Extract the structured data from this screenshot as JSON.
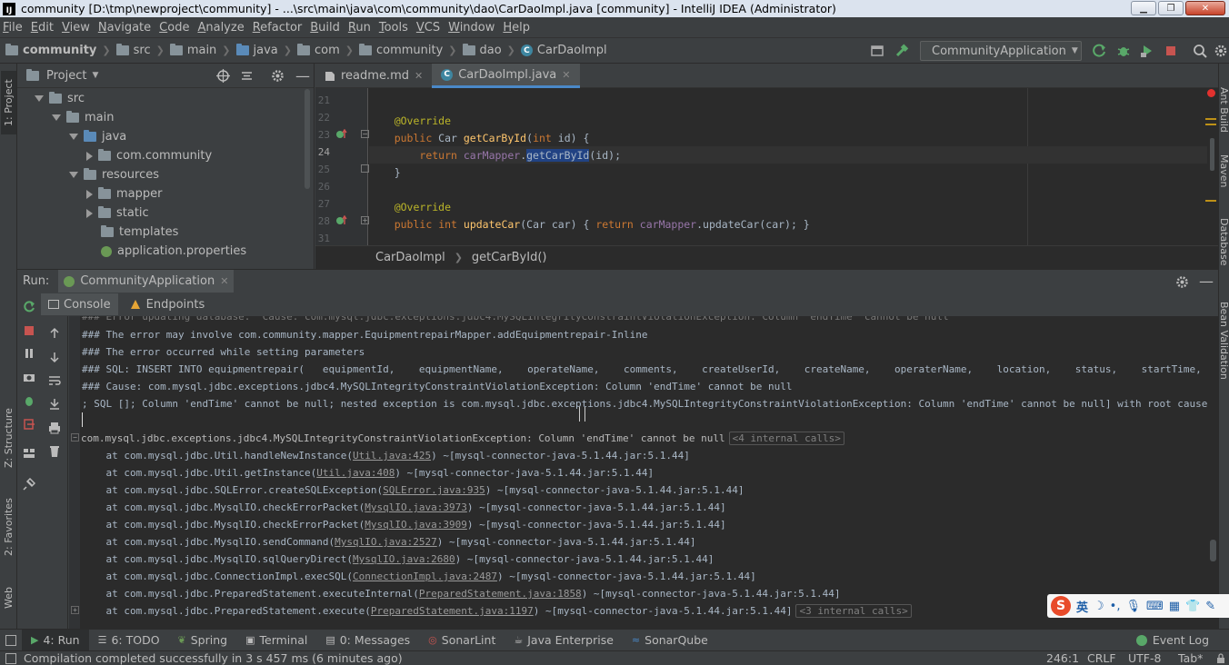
{
  "window": {
    "title": "community [D:\\tmp\\newproject\\community] - ...\\src\\main\\java\\com\\community\\dao\\CarDaoImpl.java [community] - IntelliJ IDEA (Administrator)",
    "app_icon_text": "IJ"
  },
  "menu": [
    "File",
    "Edit",
    "View",
    "Navigate",
    "Code",
    "Analyze",
    "Refactor",
    "Build",
    "Run",
    "Tools",
    "VCS",
    "Window",
    "Help"
  ],
  "breadcrumbs": [
    "community",
    "src",
    "main",
    "java",
    "com",
    "community",
    "dao",
    "CarDaoImpl"
  ],
  "run_config": {
    "name": "CommunityApplication"
  },
  "left_stripe": {
    "project": "1: Project",
    "structure": "Z: Structure",
    "favorites": "2: Favorites",
    "web": "Web"
  },
  "right_stripe": {
    "ant": "Ant Build",
    "maven": "Maven",
    "database": "Database",
    "bean": "Bean Validation"
  },
  "project_panel": {
    "title": "Project",
    "tree": [
      {
        "label": "src",
        "indent": 0,
        "state": "open",
        "icon": "folder"
      },
      {
        "label": "main",
        "indent": 1,
        "state": "open",
        "icon": "folder"
      },
      {
        "label": "java",
        "indent": 2,
        "state": "open",
        "icon": "folder-blue"
      },
      {
        "label": "com.community",
        "indent": 3,
        "state": "closed",
        "icon": "folder"
      },
      {
        "label": "resources",
        "indent": 2,
        "state": "open",
        "icon": "folder"
      },
      {
        "label": "mapper",
        "indent": 3,
        "state": "closed",
        "icon": "folder"
      },
      {
        "label": "static",
        "indent": 3,
        "state": "closed",
        "icon": "folder"
      },
      {
        "label": "templates",
        "indent": 3,
        "state": "none",
        "icon": "folder"
      },
      {
        "label": "application.properties",
        "indent": 3,
        "state": "none",
        "icon": "leaf"
      }
    ]
  },
  "editor": {
    "tabs": [
      {
        "label": "readme.md",
        "active": false
      },
      {
        "label": "CarDaoImpl.java",
        "active": true
      }
    ],
    "lines": [
      {
        "num": "21",
        "text": ""
      },
      {
        "num": "22",
        "text": "    @Override"
      },
      {
        "num": "23",
        "text": "    public Car getCarById(int id) {"
      },
      {
        "num": "24",
        "text": "        return carMapper.getCarById(id);"
      },
      {
        "num": "25",
        "text": "    }"
      },
      {
        "num": "26",
        "text": ""
      },
      {
        "num": "27",
        "text": "    @Override"
      },
      {
        "num": "28",
        "text": "    public int updateCar(Car car) { return carMapper.updateCar(car); }"
      },
      {
        "num": "31",
        "text": ""
      }
    ],
    "crumbs": [
      "CarDaoImpl",
      "getCarById()"
    ]
  },
  "run_panel": {
    "label": "Run:",
    "tab": "CommunityApplication",
    "subtabs": [
      "Console",
      "Endpoints"
    ]
  },
  "console": {
    "lines": [
      "### The error may involve com.community.mapper.EquipmentrepairMapper.addEquipmentrepair-Inline",
      "### The error occurred while setting parameters",
      "### SQL: INSERT INTO equipmentrepair(   equipmentId,    equipmentName,    operateName,    comments,    createUserId,    createName,    operaterName,    location,    status,    startTime,    endTime,    fee,",
      "### Cause: com.mysql.jdbc.exceptions.jdbc4.MySQLIntegrityConstraintViolationException: Column 'endTime' cannot be null",
      "; SQL []; Column 'endTime' cannot be null; nested exception is com.mysql.jdbc.exceptions.jdbc4.MySQLIntegrityConstraintViolationException: Column 'endTime' cannot be null] with root cause",
      ""
    ],
    "exception": "com.mysql.jdbc.exceptions.jdbc4.MySQLIntegrityConstraintViolationException: Column 'endTime' cannot be null",
    "exception_fold": "<4 internal calls>",
    "stack": [
      {
        "pre": "    at com.mysql.jdbc.Util.handleNewInstance(",
        "link": "Util.java:425",
        "post": ") ~[mysql-connector-java-5.1.44.jar:5.1.44]",
        "fold": ""
      },
      {
        "pre": "    at com.mysql.jdbc.Util.getInstance(",
        "link": "Util.java:408",
        "post": ") ~[mysql-connector-java-5.1.44.jar:5.1.44]",
        "fold": ""
      },
      {
        "pre": "    at com.mysql.jdbc.SQLError.createSQLException(",
        "link": "SQLError.java:935",
        "post": ") ~[mysql-connector-java-5.1.44.jar:5.1.44]",
        "fold": ""
      },
      {
        "pre": "    at com.mysql.jdbc.MysqlIO.checkErrorPacket(",
        "link": "MysqlIO.java:3973",
        "post": ") ~[mysql-connector-java-5.1.44.jar:5.1.44]",
        "fold": ""
      },
      {
        "pre": "    at com.mysql.jdbc.MysqlIO.checkErrorPacket(",
        "link": "MysqlIO.java:3909",
        "post": ") ~[mysql-connector-java-5.1.44.jar:5.1.44]",
        "fold": ""
      },
      {
        "pre": "    at com.mysql.jdbc.MysqlIO.sendCommand(",
        "link": "MysqlIO.java:2527",
        "post": ") ~[mysql-connector-java-5.1.44.jar:5.1.44]",
        "fold": ""
      },
      {
        "pre": "    at com.mysql.jdbc.MysqlIO.sqlQueryDirect(",
        "link": "MysqlIO.java:2680",
        "post": ") ~[mysql-connector-java-5.1.44.jar:5.1.44]",
        "fold": ""
      },
      {
        "pre": "    at com.mysql.jdbc.ConnectionImpl.execSQL(",
        "link": "ConnectionImpl.java:2487",
        "post": ") ~[mysql-connector-java-5.1.44.jar:5.1.44]",
        "fold": ""
      },
      {
        "pre": "    at com.mysql.jdbc.PreparedStatement.executeInternal(",
        "link": "PreparedStatement.java:1858",
        "post": ") ~[mysql-connector-java-5.1.44.jar:5.1.44]",
        "fold": ""
      },
      {
        "pre": "    at com.mysql.jdbc.PreparedStatement.execute(",
        "link": "PreparedStatement.java:1197",
        "post": ") ~[mysql-connector-java-5.1.44.jar:5.1.44]",
        "fold": "<3 internal calls>"
      }
    ]
  },
  "bottom_tabs": [
    {
      "label": "4: Run",
      "active": true,
      "icon": "run-icon"
    },
    {
      "label": "6: TODO",
      "active": false,
      "icon": "todo-icon"
    },
    {
      "label": "Spring",
      "active": false,
      "icon": "spring-icon"
    },
    {
      "label": "Terminal",
      "active": false,
      "icon": "terminal-icon"
    },
    {
      "label": "0: Messages",
      "active": false,
      "icon": "messages-icon"
    },
    {
      "label": "SonarLint",
      "active": false,
      "icon": "sonarlint-icon"
    },
    {
      "label": "Java Enterprise",
      "active": false,
      "icon": "java-enterprise-icon"
    },
    {
      "label": "SonarQube",
      "active": false,
      "icon": "sonarqube-icon"
    }
  ],
  "event_log": "Event Log",
  "status": {
    "message": "Compilation completed successfully in 3 s 457 ms (6 minutes ago)",
    "position": "246:1",
    "line_sep": "CRLF",
    "encoding": "UTF-8",
    "indent": "Tab*"
  },
  "ime": {
    "logo": "S",
    "lang": "英"
  },
  "colors": {
    "accent": "#4a88c7",
    "bg": "#3c3f41",
    "editor_bg": "#2b2b2b"
  }
}
